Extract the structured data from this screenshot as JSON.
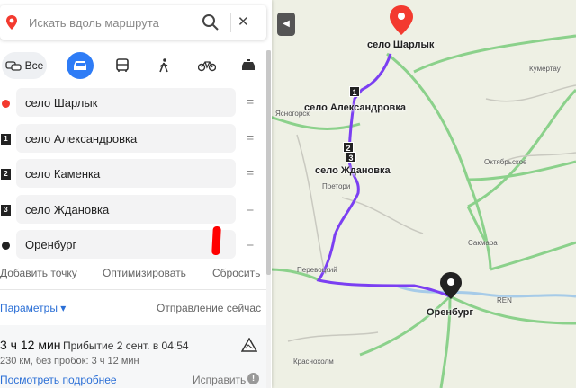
{
  "search": {
    "placeholder": "Искать вдоль маршрута"
  },
  "modes": {
    "all_label": "Все"
  },
  "waypoints": [
    {
      "label": "село Шарлык",
      "marker": "dot",
      "color": "#f33a2f"
    },
    {
      "label": "село Александровка",
      "marker": "1"
    },
    {
      "label": "село Каменка",
      "marker": "2"
    },
    {
      "label": "село Ждановка",
      "marker": "3"
    },
    {
      "label": "Оренбург",
      "marker": "dot",
      "color": "#222222"
    }
  ],
  "actions": {
    "add_point": "Добавить точку",
    "optimize": "Оптимизировать",
    "reset": "Сбросить"
  },
  "params": {
    "label": "Параметры ▾",
    "departure": "Отправление сейчас"
  },
  "route": {
    "duration": "3 ч 12 мин",
    "arrival": "Прибытие 2 сент. в 04:54",
    "distance": "230 км, без пробок: 3 ч 12 мин",
    "details_link": "Посмотреть подробнее",
    "fix_label": "Исправить"
  },
  "map": {
    "labels": {
      "sharlyk": "село Шарлык",
      "aleksandrovka": "село Александровка",
      "zhdanovka": "село Ждановка",
      "orenburg": "Оренбург",
      "kumertau": "Кумертау",
      "oktyabrskoe": "Октябрьское",
      "sakmara": "Сакмара",
      "pretoria": "Претори",
      "yasnogorsk": "Ясногорск",
      "perevolotsky": "Перевоцкий",
      "krasnokholm": "Краснохолм",
      "ren": "REN"
    },
    "waypoint_markers": [
      "1",
      "2",
      "3"
    ],
    "route_color": "#7b3ff2",
    "road_color": "#8bd18b"
  }
}
